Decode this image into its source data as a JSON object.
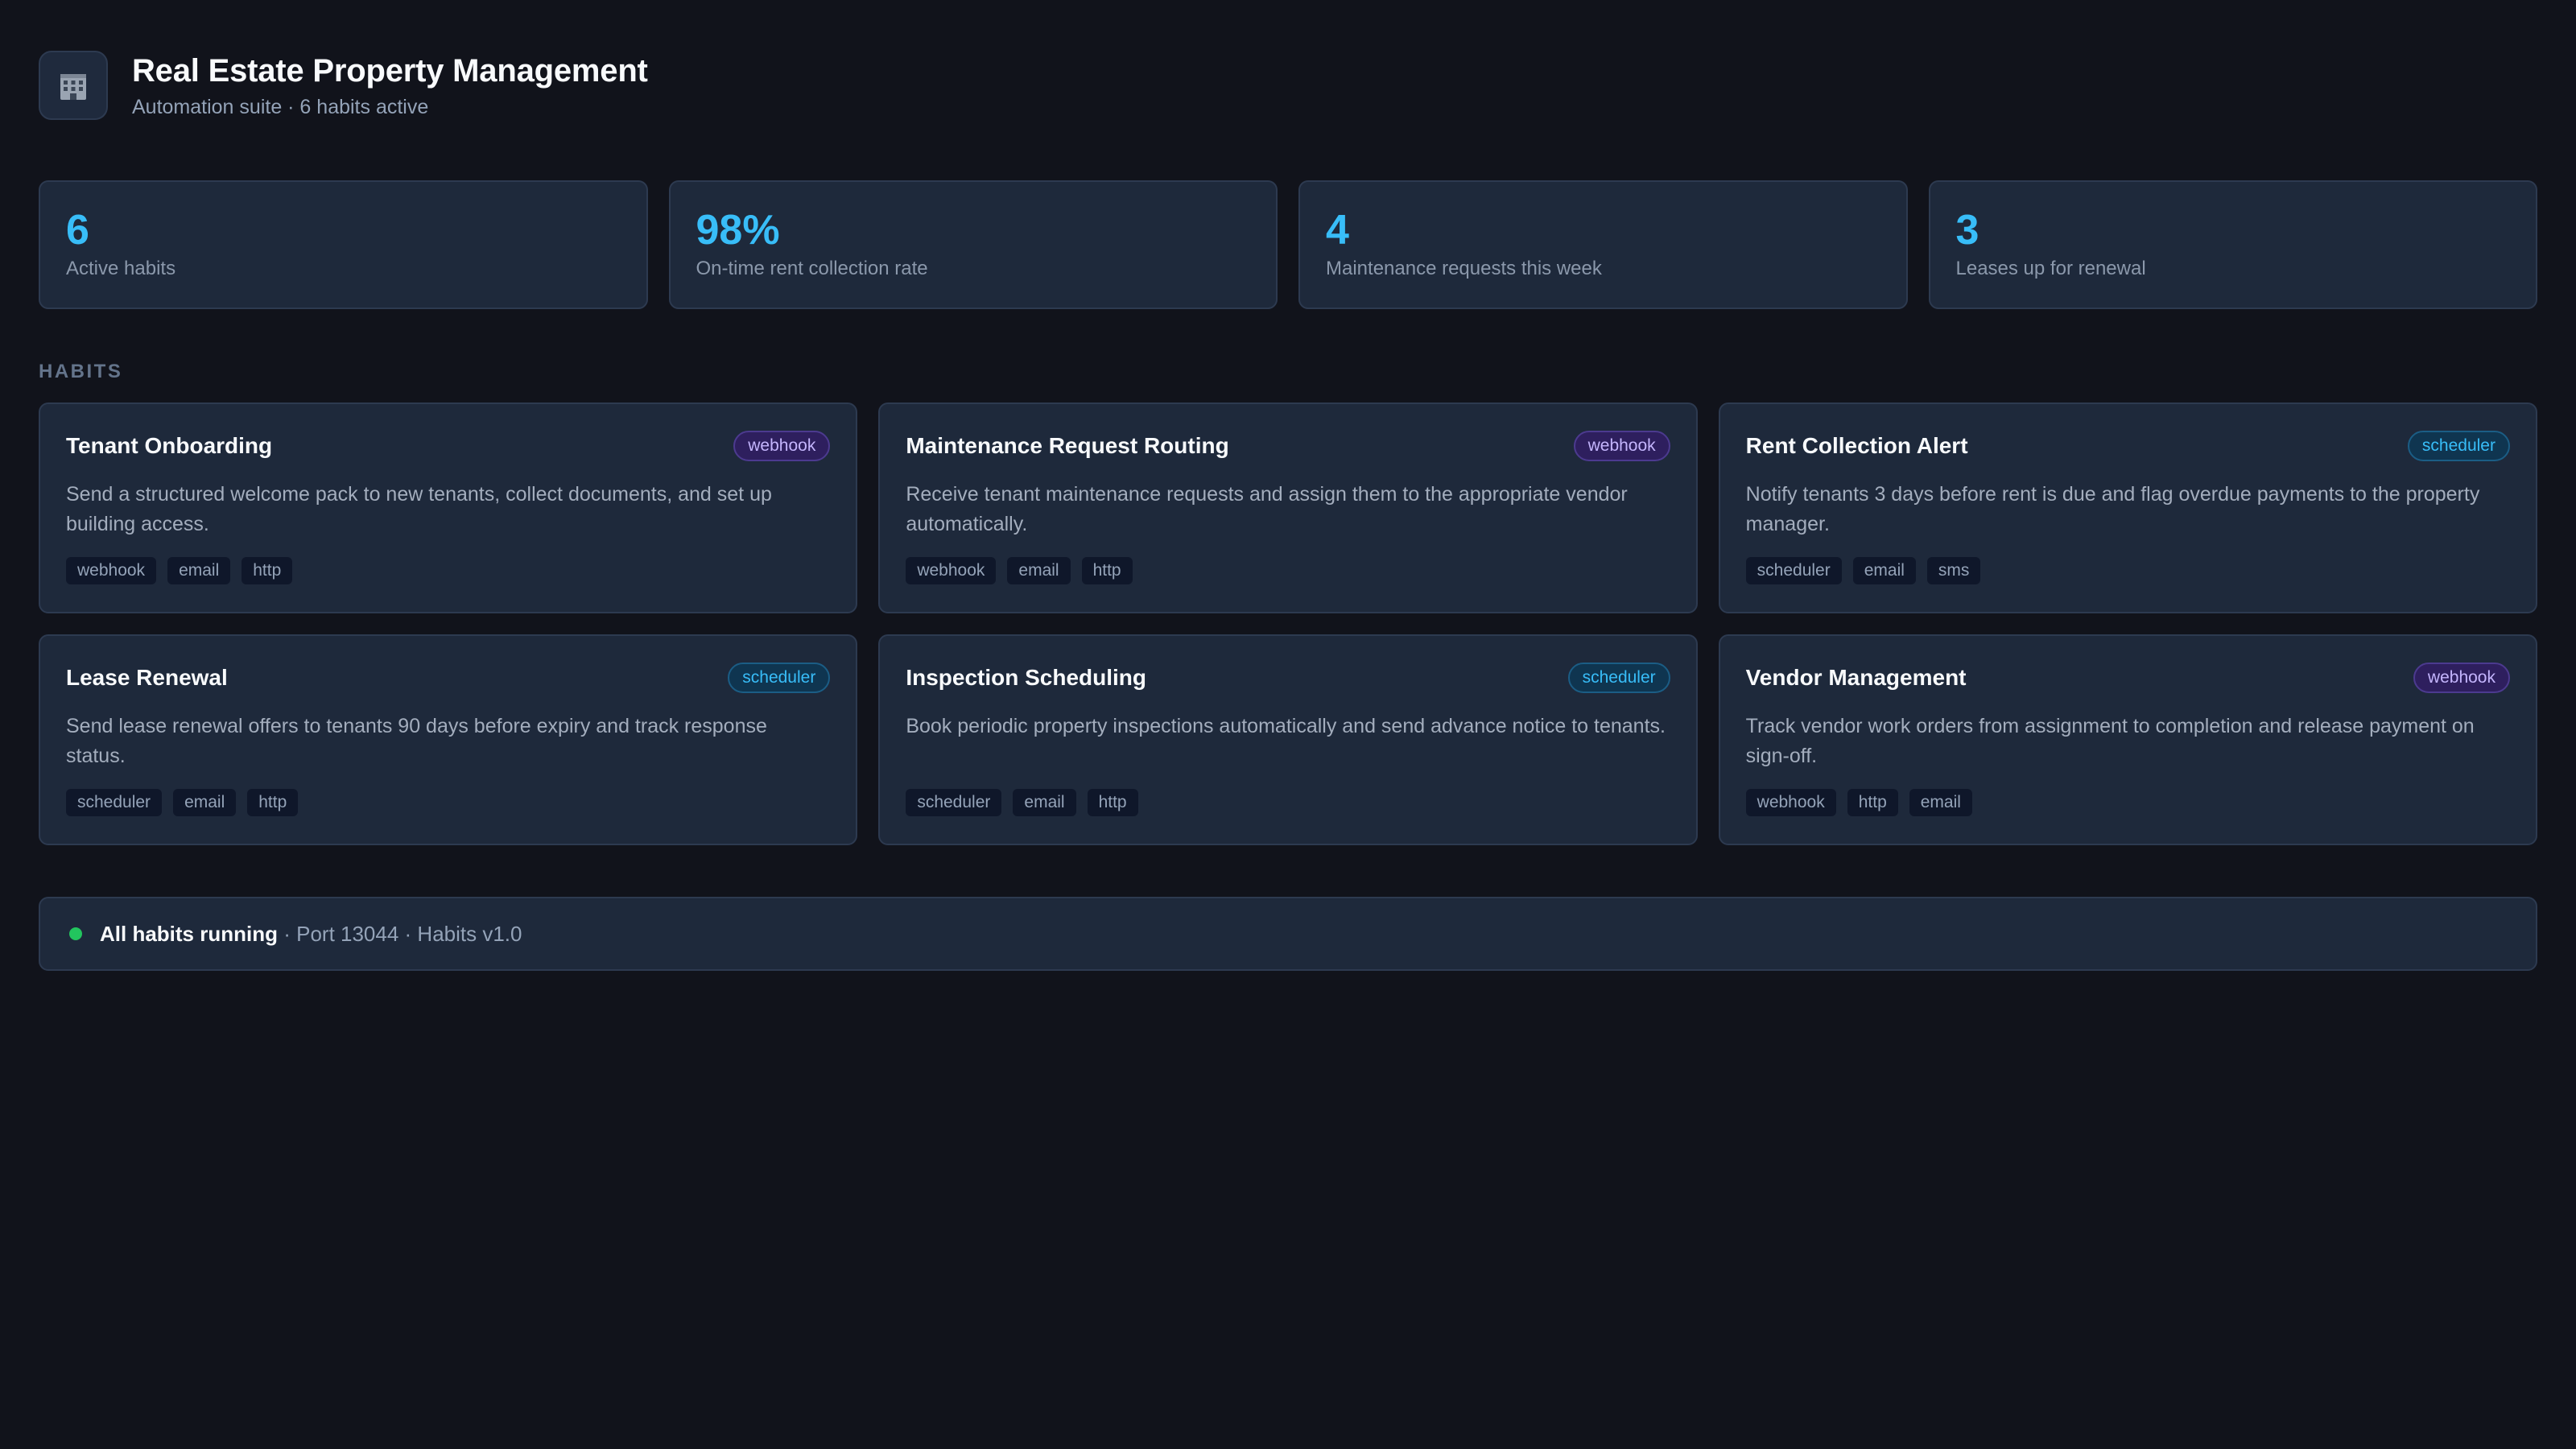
{
  "header": {
    "icon": "building-icon",
    "title": "Real Estate Property Management",
    "subtitle": "Automation suite · 6 habits active"
  },
  "stats": [
    {
      "value": "6",
      "label": "Active habits"
    },
    {
      "value": "98%",
      "label": "On-time rent collection rate"
    },
    {
      "value": "4",
      "label": "Maintenance requests this week"
    },
    {
      "value": "3",
      "label": "Leases up for renewal"
    }
  ],
  "section_label": "HABITS",
  "habits": [
    {
      "name": "Tenant Onboarding",
      "trigger": "webhook",
      "description": "Send a structured welcome pack to new tenants, collect documents, and set up building access.",
      "tags": [
        "webhook",
        "email",
        "http"
      ]
    },
    {
      "name": "Maintenance Request Routing",
      "trigger": "webhook",
      "description": "Receive tenant maintenance requests and assign them to the appropriate vendor automatically.",
      "tags": [
        "webhook",
        "email",
        "http"
      ]
    },
    {
      "name": "Rent Collection Alert",
      "trigger": "scheduler",
      "description": "Notify tenants 3 days before rent is due and flag overdue payments to the property manager.",
      "tags": [
        "scheduler",
        "email",
        "sms"
      ]
    },
    {
      "name": "Lease Renewal",
      "trigger": "scheduler",
      "description": "Send lease renewal offers to tenants 90 days before expiry and track response status.",
      "tags": [
        "scheduler",
        "email",
        "http"
      ]
    },
    {
      "name": "Inspection Scheduling",
      "trigger": "scheduler",
      "description": "Book periodic property inspections automatically and send advance notice to tenants.",
      "tags": [
        "scheduler",
        "email",
        "http"
      ]
    },
    {
      "name": "Vendor Management",
      "trigger": "webhook",
      "description": "Track vendor work orders from assignment to completion and release payment on sign-off.",
      "tags": [
        "webhook",
        "http",
        "email"
      ]
    }
  ],
  "status": {
    "main": "All habits running",
    "separator": " · ",
    "meta": "Port 13044 · Habits v1.0",
    "color": "#22c55e"
  },
  "colors": {
    "accent": "#38bdf8",
    "webhook": "#c4b5fd",
    "scheduler": "#38bdf8",
    "background": "#11131b",
    "card": "#1e293b"
  }
}
